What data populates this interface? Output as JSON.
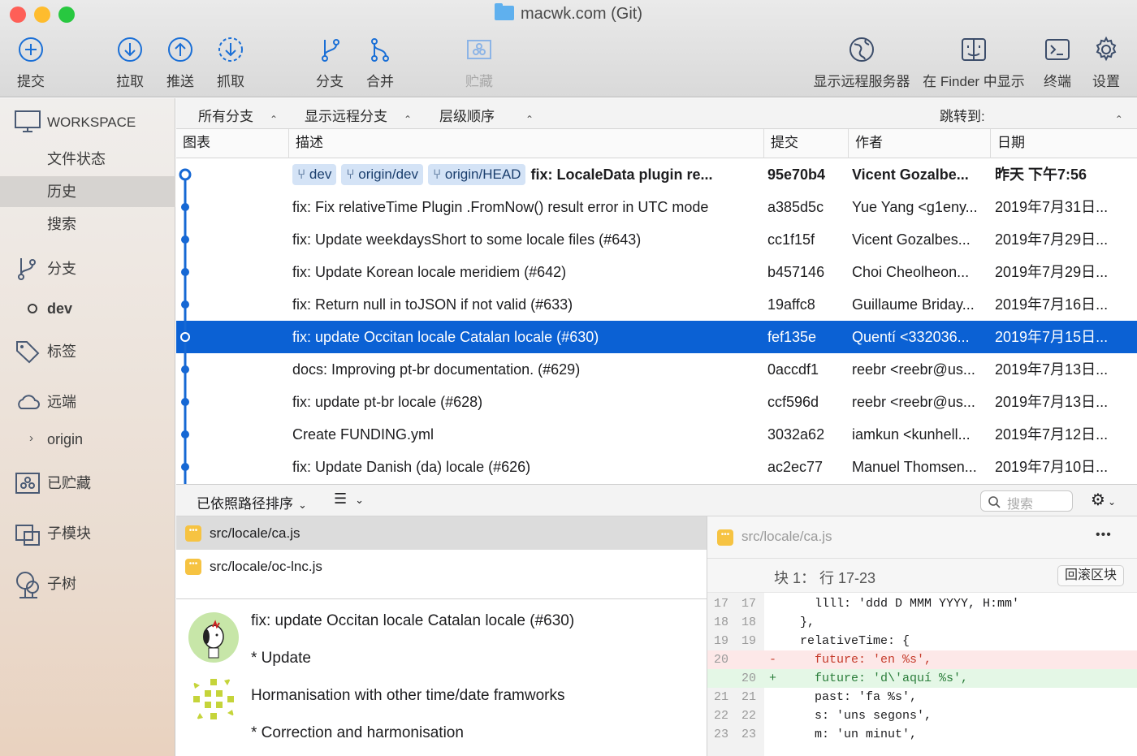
{
  "window": {
    "title": "macwk.com (Git)"
  },
  "toolbar": {
    "commit": "提交",
    "pull": "拉取",
    "push": "推送",
    "fetch": "抓取",
    "branch": "分支",
    "merge": "合并",
    "stash": "贮藏",
    "show_remote": "显示远程服务器",
    "finder": "在 Finder 中显示",
    "terminal": "终端",
    "settings": "设置"
  },
  "sidebar": {
    "workspace": "WORKSPACE",
    "file_status": "文件状态",
    "history": "历史",
    "search": "搜索",
    "branches": "分支",
    "current_branch": "dev",
    "tags": "标签",
    "remotes": "远端",
    "origin": "origin",
    "stashes": "已贮藏",
    "submodules": "子模块",
    "subtrees": "子树"
  },
  "filters": {
    "all_branches": "所有分支",
    "show_remote": "显示远程分支",
    "order": "层级顺序",
    "jump_to": "跳转到:"
  },
  "columns": {
    "graph": "图表",
    "description": "描述",
    "commit": "提交",
    "author": "作者",
    "date": "日期"
  },
  "commits": [
    {
      "tags": [
        "dev",
        "origin/dev",
        "origin/HEAD"
      ],
      "desc": "fix: LocaleData plugin re...",
      "hash": "95e70b4",
      "author": "Vicent Gozalbe...",
      "date": "昨天 下午7:56",
      "bold": true
    },
    {
      "tags": [],
      "desc": "fix: Fix relativeTime Plugin .FromNow() result error in UTC mode",
      "hash": "a385d5c",
      "author": "Yue Yang <g1eny...",
      "date": "2019年7月31日..."
    },
    {
      "tags": [],
      "desc": "fix: Update weekdaysShort to some locale files (#643)",
      "hash": "cc1f15f",
      "author": "Vicent Gozalbes...",
      "date": "2019年7月29日..."
    },
    {
      "tags": [],
      "desc": "fix: Update Korean locale meridiem (#642)",
      "hash": "b457146",
      "author": "Choi Cheolheon...",
      "date": "2019年7月29日..."
    },
    {
      "tags": [],
      "desc": "fix: Return null in toJSON if not valid (#633)",
      "hash": "19affc8",
      "author": "Guillaume Briday...",
      "date": "2019年7月16日..."
    },
    {
      "tags": [],
      "desc": "fix: update Occitan locale Catalan locale (#630)",
      "hash": "fef135e",
      "author": "Quentí <332036...",
      "date": "2019年7月15日...",
      "selected": true
    },
    {
      "tags": [],
      "desc": "docs: Improving pt-br documentation. (#629)",
      "hash": "0accdf1",
      "author": "reebr <reebr@us...",
      "date": "2019年7月13日..."
    },
    {
      "tags": [],
      "desc": "fix: update pt-br locale (#628)",
      "hash": "ccf596d",
      "author": "reebr <reebr@us...",
      "date": "2019年7月13日..."
    },
    {
      "tags": [],
      "desc": "Create FUNDING.yml",
      "hash": "3032a62",
      "author": "iamkun <kunhell...",
      "date": "2019年7月12日..."
    },
    {
      "tags": [],
      "desc": "fix: Update Danish (da) locale (#626)",
      "hash": "ac2ec77",
      "author": "Manuel Thomsen...",
      "date": "2019年7月10日..."
    }
  ],
  "lower": {
    "sort": "已依照路径排序",
    "search_placeholder": "搜索"
  },
  "files": [
    "src/locale/ca.js",
    "src/locale/oc-lnc.js"
  ],
  "message": {
    "line1": "fix: update Occitan locale Catalan locale (#630)",
    "line2": "* Update",
    "line3": "Hormanisation with other time/date framworks",
    "line4": "* Correction and harmonisation"
  },
  "diff": {
    "file": "src/locale/ca.js",
    "more": "•••",
    "hunk": "块 1： 行 17-23",
    "revert": "回滚区块",
    "lines": [
      {
        "o": "17",
        "n": "17",
        "m": "",
        "t": "    llll: 'ddd D MMM YYYY, H:mm'",
        "k": "ctx"
      },
      {
        "o": "18",
        "n": "18",
        "m": "",
        "t": "  },",
        "k": "ctx"
      },
      {
        "o": "19",
        "n": "19",
        "m": "",
        "t": "  relativeTime: {",
        "k": "ctx"
      },
      {
        "o": "20",
        "n": "",
        "m": "-",
        "t": "    future: 'en %s',",
        "k": "del"
      },
      {
        "o": "",
        "n": "20",
        "m": "+",
        "t": "    future: 'd\\'aquí %s',",
        "k": "add"
      },
      {
        "o": "21",
        "n": "21",
        "m": "",
        "t": "    past: 'fa %s',",
        "k": "ctx"
      },
      {
        "o": "22",
        "n": "22",
        "m": "",
        "t": "    s: 'uns segons',",
        "k": "ctx"
      },
      {
        "o": "23",
        "n": "23",
        "m": "",
        "t": "    m: 'un minut',",
        "k": "ctx"
      }
    ]
  },
  "colors": {
    "accent": "#0b61d4",
    "icon_blue": "#1a6fd6",
    "graph": "#1668d4"
  }
}
